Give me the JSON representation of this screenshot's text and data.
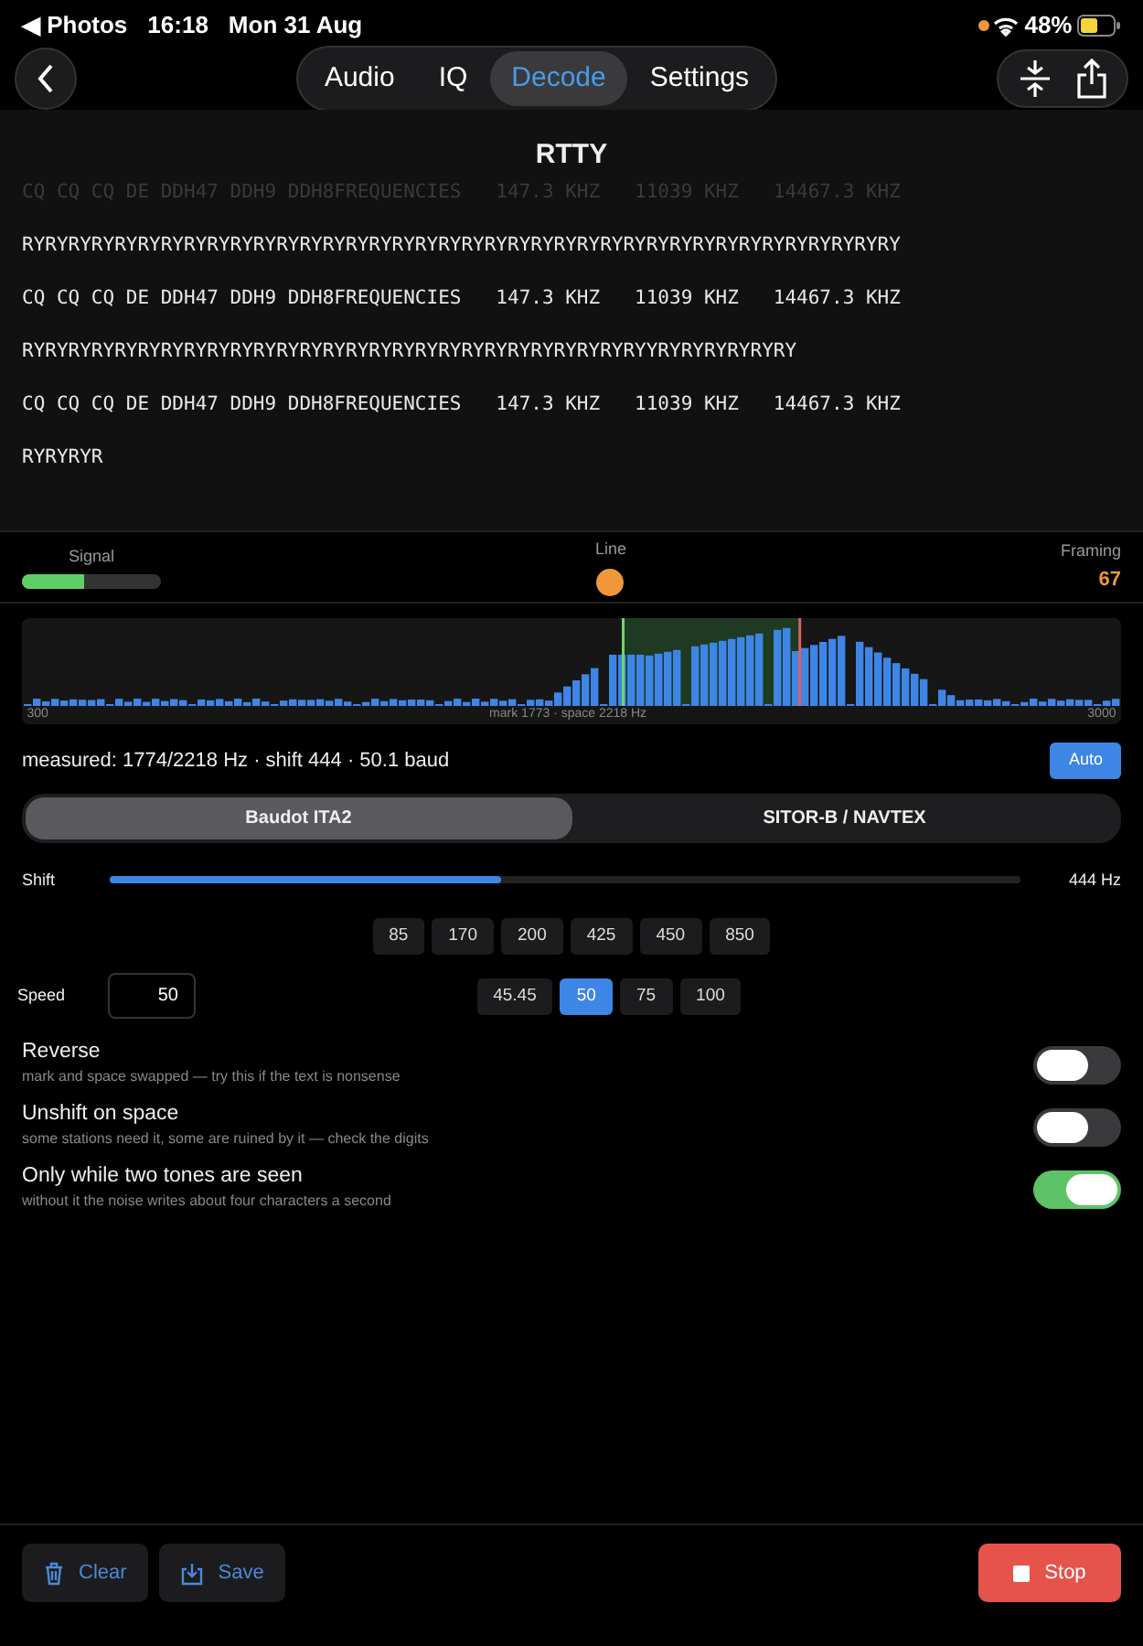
{
  "status_bar": {
    "back_app": "◀ Photos",
    "time": "16:18",
    "date": "Mon 31 Aug",
    "battery": "48%"
  },
  "tabs": [
    {
      "label": "Audio",
      "selected": false
    },
    {
      "label": "IQ",
      "selected": false
    },
    {
      "label": "Decode",
      "selected": true
    },
    {
      "label": "Settings",
      "selected": false
    }
  ],
  "decoder": {
    "title": "RTTY",
    "lines": [
      {
        "text": "CQ CQ CQ DE DDH47 DDH9 DDH8FREQUENCIES   147.3 KHZ   11039 KHZ   14467.3 KHZ",
        "faded": true
      },
      {
        "text": "RYRYRYRYRYRYRYRYRYRYRYRYRYRYRYRYRYRYRYRYRYRYRYRYRYRYRYRYRYRYRYRYRYRYRYRYRYRY",
        "faded": false
      },
      {
        "text": "CQ CQ CQ DE DDH47 DDH9 DDH8FREQUENCIES   147.3 KHZ   11039 KHZ   14467.3 KHZ",
        "faded": false
      },
      {
        "text": "RYRYRYRYRYRYRYRYRYRYRYRYRYRYRYRYRYRYRYRYRYRYRYRYRYRYRYYRYRYRYRYRYRY",
        "faded": false
      },
      {
        "text": "CQ CQ CQ DE DDH47 DDH9 DDH8FREQUENCIES   147.3 KHZ   11039 KHZ   14467.3 KHZ",
        "faded": false
      },
      {
        "text": "RYRYRYR",
        "faded": false
      }
    ]
  },
  "meters": {
    "signal": {
      "label": "Signal",
      "level": 0.45
    },
    "line": {
      "label": "Line",
      "color": "#f0973a"
    },
    "framing": {
      "label": "Framing",
      "value": "67"
    }
  },
  "spectrum": {
    "min_label": "300",
    "max_label": "3000",
    "marker_label": "mark 1773 · space 2218 Hz"
  },
  "measured": "measured: 1774/2218 Hz · shift 444 · 50.1 baud",
  "auto_button": "Auto",
  "modes": [
    {
      "label": "Baudot ITA2",
      "selected": true
    },
    {
      "label": "SITOR-B / NAVTEX",
      "selected": false
    }
  ],
  "shift": {
    "label": "Shift",
    "level": 0.43,
    "reading": "444 Hz",
    "presets": [
      "85",
      "170",
      "200",
      "425",
      "450",
      "850"
    ]
  },
  "speed": {
    "label": "Speed",
    "value": "50",
    "presets": [
      {
        "label": "45.45",
        "selected": false
      },
      {
        "label": "50",
        "selected": true
      },
      {
        "label": "75",
        "selected": false
      },
      {
        "label": "100",
        "selected": false
      }
    ]
  },
  "options": [
    {
      "title": "Reverse",
      "hint": "mark and space swapped — try this if the text is nonsense",
      "on": false
    },
    {
      "title": "Unshift on space",
      "hint": "some stations need it, some are ruined by it — check the digits",
      "on": false
    },
    {
      "title": "Only while two tones are seen",
      "hint": "without it the noise writes about four characters a second",
      "on": true
    }
  ],
  "footer": {
    "clear": "Clear",
    "save": "Save",
    "stop": "Stop"
  }
}
